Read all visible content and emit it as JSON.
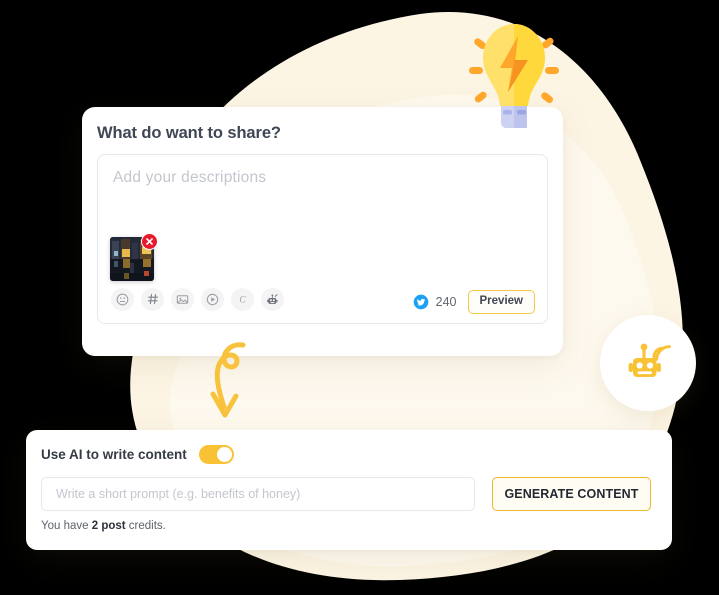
{
  "theme": {
    "accent": "#F8C234",
    "accent_border": "#EEB82A",
    "blob_fill": "#FDF5E4",
    "page_bg": "#000000",
    "card_bg": "#FFFFFF",
    "twitter_blue": "#1DA1F2",
    "danger_red": "#E8192C",
    "bulb_yellow": "#FFD93B",
    "bulb_bolt_orange": "#FFA62B",
    "bulb_base_lavender": "#CDD2F2",
    "text_dark": "#3F4654",
    "text_muted": "#C3C6CD"
  },
  "composer": {
    "title": "What do want to share?",
    "description_placeholder": "Add your descriptions",
    "description_value": "",
    "attachment": {
      "alt": "night street photo thumbnail",
      "remove_label": "×"
    },
    "toolbar": [
      {
        "name": "emoji-icon",
        "label": "Emoji"
      },
      {
        "name": "hashtag-icon",
        "label": "Hashtag"
      },
      {
        "name": "image-icon",
        "label": "Image"
      },
      {
        "name": "video-icon",
        "label": "Video"
      },
      {
        "name": "canva-icon",
        "label": "Canva"
      },
      {
        "name": "robot-icon",
        "label": "AI assistant"
      }
    ],
    "network": {
      "icon": "twitter-icon",
      "name": "Twitter",
      "char_count": "240"
    },
    "preview_label": "Preview"
  },
  "ai_panel": {
    "toggle_label": "Use AI to write content",
    "toggle_on": true,
    "prompt_placeholder": "Write a short prompt (e.g. benefits of honey)",
    "prompt_value": "",
    "generate_label": "GENERATE CONTENT",
    "credits_prefix": "You have ",
    "credits_amount": "2 post",
    "credits_suffix": " credits."
  },
  "decorations": {
    "lightbulb": "lightbulb-icon",
    "curly_arrow": "curly-arrow-down-icon",
    "robot_bubble": "robot-wifi-icon"
  }
}
